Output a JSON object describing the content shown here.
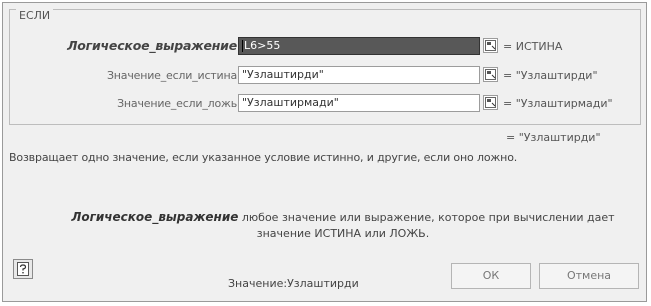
{
  "dialog": {
    "function_name": "ЕСЛИ",
    "arguments": [
      {
        "label": "Логическое_выражение",
        "value": "L6>55",
        "result": "= ИСТИНА",
        "bold": true,
        "active": true
      },
      {
        "label": "Значение_если_истина",
        "value": "\"Узлаштирди\"",
        "result": "= \"Узлаштирди\""
      },
      {
        "label": "Значение_если_ложь",
        "value": "\"Узлаштирмади\"",
        "result": "= \"Узлаштирмади\""
      }
    ],
    "overall_result": "= \"Узлаштирди\"",
    "function_description": "Возвращает одно значение, если указанное условие истинно, и другие, если оно ложно.",
    "argument_help": {
      "name": "Логическое_выражение",
      "text_line1": " любое значение или выражение, которое при вычислении дает",
      "text_line2": "значение ИСТИНА или ЛОЖЬ."
    },
    "value_line": "Значение:Узлаштирди",
    "buttons": {
      "ok": "ОК",
      "cancel": "Отмена"
    }
  },
  "icons": {
    "collapse": "collapse-dialog-icon",
    "help": "help-icon"
  }
}
